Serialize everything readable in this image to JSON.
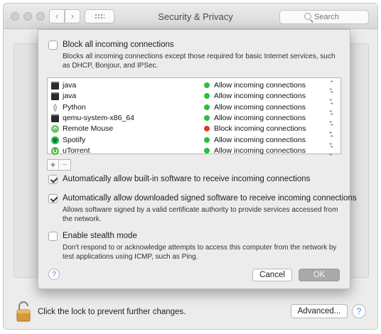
{
  "window": {
    "title": "Security & Privacy",
    "search_placeholder": "Search",
    "nav_back": "‹",
    "nav_forward": "›"
  },
  "sheet": {
    "block_all": {
      "label": "Block all incoming connections",
      "checked": false,
      "description": "Blocks all incoming connections except those required for basic Internet services, such as DHCP, Bonjour, and IPSec."
    },
    "apps": [
      {
        "name": "java",
        "icon": "terminal-icon",
        "policy": "Allow incoming connections",
        "status_color": "#2cbf3a"
      },
      {
        "name": "java",
        "icon": "terminal-icon",
        "policy": "Allow incoming connections",
        "status_color": "#2cbf3a"
      },
      {
        "name": "Python",
        "icon": "python-rocket-icon",
        "policy": "Allow incoming connections",
        "status_color": "#2cbf3a"
      },
      {
        "name": "qemu-system-x86_64",
        "icon": "terminal-icon",
        "policy": "Allow incoming connections",
        "status_color": "#2cbf3a"
      },
      {
        "name": "Remote Mouse",
        "icon": "remote-mouse-icon",
        "policy": "Block incoming connections",
        "status_color": "#e0392f"
      },
      {
        "name": "Spotify",
        "icon": "spotify-icon",
        "policy": "Allow incoming connections",
        "status_color": "#2cbf3a"
      },
      {
        "name": "uTorrent",
        "icon": "utorrent-icon",
        "policy": "Allow incoming connections",
        "status_color": "#2cbf3a"
      }
    ],
    "add_label": "+",
    "remove_label": "−",
    "auto_builtin": {
      "label": "Automatically allow built-in software to receive incoming connections",
      "checked": true
    },
    "auto_signed": {
      "label": "Automatically allow downloaded signed software to receive incoming connections",
      "checked": true,
      "description": "Allows software signed by a valid certificate authority to provide services accessed from the network."
    },
    "stealth": {
      "label": "Enable stealth mode",
      "checked": false,
      "description": "Don't respond to or acknowledge attempts to access this computer from the network by test applications using ICMP, such as Ping."
    },
    "help_label": "?",
    "cancel_label": "Cancel",
    "ok_label": "OK"
  },
  "footer": {
    "lock_text": "Click the lock to prevent further changes.",
    "advanced_label": "Advanced...",
    "help_label": "?"
  }
}
